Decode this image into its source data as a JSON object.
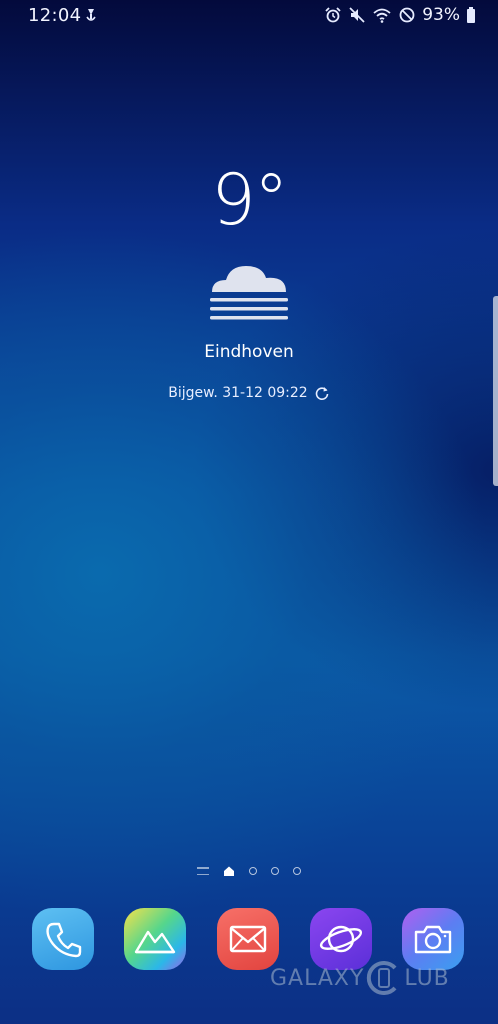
{
  "status_bar": {
    "time": "12:04",
    "battery_percent": "93%",
    "left_icons": [
      "mic-notification-icon"
    ],
    "right_icons": [
      "alarm-icon",
      "mute-icon",
      "wifi-icon",
      "do-not-disturb-icon",
      "battery-icon"
    ]
  },
  "weather": {
    "temperature": "9°",
    "condition_icon": "fog-icon",
    "city": "Eindhoven",
    "updated": "Bijgew. 31-12 09:22",
    "refresh_icon": "refresh-icon"
  },
  "page_indicator": {
    "pages": 5,
    "current": 1,
    "items": [
      "lines",
      "home",
      "dot",
      "dot",
      "dot"
    ]
  },
  "dock": {
    "apps": [
      {
        "name": "Telefoon",
        "icon": "phone-icon"
      },
      {
        "name": "Galerij",
        "icon": "gallery-icon"
      },
      {
        "name": "E-mail",
        "icon": "email-icon"
      },
      {
        "name": "Internet",
        "icon": "internet-icon"
      },
      {
        "name": "Camera",
        "icon": "camera-icon"
      }
    ]
  },
  "watermark": {
    "left": "GALAXY",
    "right": "LUB"
  },
  "colors": {
    "wallpaper_top": "#030a3c",
    "wallpaper_mid": "#0b52a6",
    "phone": "#3aa5e8",
    "email": "#e95550",
    "internet": "#6a38e0"
  }
}
